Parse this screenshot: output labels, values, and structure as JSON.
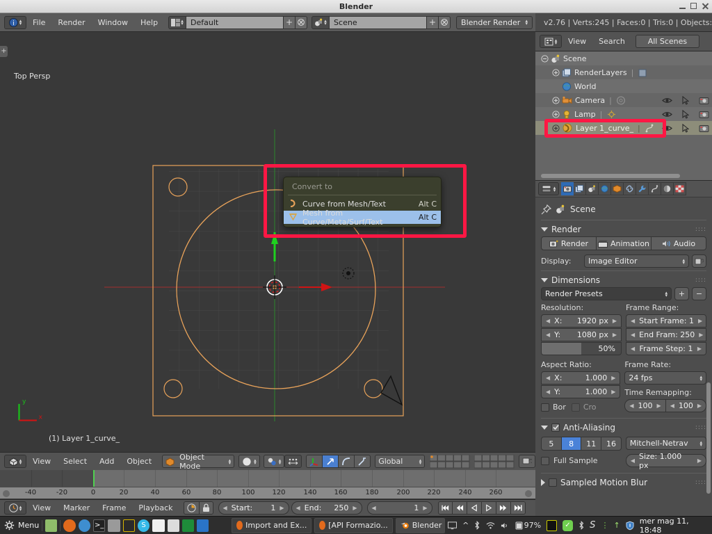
{
  "window": {
    "title": "Blender",
    "buttons": {
      "minimize": "minimize-button",
      "maximize": "maximize-button",
      "close": "close-button"
    }
  },
  "info_header": {
    "editor_type": "info-editor",
    "menus": [
      "File",
      "Render",
      "Window",
      "Help"
    ],
    "screen_layout": {
      "value": "Default",
      "add": "+",
      "remove": "x"
    },
    "scene": {
      "value": "Scene",
      "add": "+",
      "remove": "x"
    },
    "engine": {
      "value": "Blender Render"
    },
    "stats": "v2.76 | Verts:245 | Faces:0 | Tris:0 | Objects:"
  },
  "viewport": {
    "view_label": "Top Persp",
    "object_label": "(1) Layer 1_curve_",
    "axis_x": "x",
    "axis_y": "y",
    "plus_toggle": "+",
    "colors": {
      "curve": "#e9a35a",
      "grid": "#4a4a4a",
      "axis_x": "#a03232",
      "axis_y": "#3a8a3a",
      "bg": "#393939",
      "highlight_red": "#ff1744"
    }
  },
  "popup": {
    "title": "Convert to",
    "items": [
      {
        "label": "Curve from Mesh/Text",
        "underline": "C",
        "shortcut": "Alt C",
        "icon": "curve-icon",
        "highlighted": false
      },
      {
        "label": "Mesh from Curve/Meta/Surf/Text",
        "underline": "M",
        "shortcut": "Alt C",
        "icon": "mesh-cone-icon",
        "highlighted": true
      }
    ]
  },
  "viewport_header": {
    "editor_type": "3d-view-editor",
    "menus": [
      "View",
      "Select",
      "Add",
      "Object"
    ],
    "mode": "Object Mode",
    "viewport_shading": "solid-shading",
    "pivot": "pivot-median-point",
    "snap": "snap-magnet",
    "manipulators": [
      "translate-manipulator",
      "rotate-manipulator",
      "scale-manipulator"
    ],
    "transform_orientation": "Global",
    "layers": "layer-grid",
    "lock_scene": "lock-to-scene-icon",
    "proportional": "proportional-editing-icon"
  },
  "timeline": {
    "editor_type": "timeline-editor",
    "menus": [
      "View",
      "Marker",
      "Frame",
      "Playback"
    ],
    "auto_key": "record-icon",
    "lock": "lock-icon",
    "start_label": "Start:",
    "start_value": "1",
    "end_label": "End:",
    "end_value": "250",
    "current_frame": "1",
    "playhead_frame": 0,
    "ruler_ticks": [
      "-40",
      "-20",
      "0",
      "20",
      "40",
      "60",
      "80",
      "100",
      "120",
      "140",
      "160",
      "180",
      "200",
      "220",
      "240",
      "260"
    ],
    "transport": [
      "jump-start",
      "prev-keyframe",
      "play-reverse",
      "play",
      "next-keyframe",
      "jump-end"
    ]
  },
  "outliner": {
    "header": {
      "editor_type": "outliner-editor",
      "menus": [
        "View",
        "Search"
      ],
      "display_mode": "All Scenes"
    },
    "rows": [
      {
        "name": "Scene",
        "icon": "scene-icon",
        "depth": 0,
        "expander": "collapse",
        "selected": true,
        "has_toggles": false,
        "extra_icon": ""
      },
      {
        "name": "RenderLayers",
        "icon": "renderlayers-icon",
        "depth": 1,
        "expander": "expand",
        "selected": false,
        "has_toggles": false,
        "extra_icon": "renderlayers-data-icon"
      },
      {
        "name": "World",
        "icon": "world-icon",
        "depth": 1,
        "expander": "",
        "selected": false,
        "has_toggles": false,
        "extra_icon": ""
      },
      {
        "name": "Camera",
        "icon": "camera-icon",
        "depth": 1,
        "expander": "expand",
        "selected": false,
        "has_toggles": true,
        "extra_icon": "camera-data-icon"
      },
      {
        "name": "Lamp",
        "icon": "lamp-icon",
        "depth": 1,
        "expander": "expand",
        "selected": false,
        "has_toggles": true,
        "extra_icon": "lamp-data-icon"
      },
      {
        "name": "Layer 1_curve_",
        "icon": "curve-object-icon",
        "depth": 1,
        "expander": "expand",
        "selected": true,
        "has_toggles": true,
        "extra_icon": "curve-data-icon"
      }
    ],
    "row_toggles": [
      "eye-icon",
      "cursor-arrow-icon",
      "camera-render-icon"
    ]
  },
  "properties": {
    "tabs": [
      {
        "name": "render-tab",
        "sel": true
      },
      {
        "name": "render-layers-tab",
        "sel": false
      },
      {
        "name": "scene-tab",
        "sel": false
      },
      {
        "name": "world-tab",
        "sel": false
      },
      {
        "name": "object-tab",
        "sel": false
      },
      {
        "name": "constraints-tab",
        "sel": false
      },
      {
        "name": "modifiers-tab",
        "sel": false
      },
      {
        "name": "data-tab",
        "sel": false
      },
      {
        "name": "material-tab",
        "sel": false
      },
      {
        "name": "texture-tab",
        "sel": false
      }
    ],
    "breadcrumb": "Scene",
    "panels": {
      "render": {
        "title": "Render",
        "buttons": [
          "Render",
          "Animation",
          "Audio"
        ],
        "display_label": "Display:",
        "display_value": "Image Editor"
      },
      "dimensions": {
        "title": "Dimensions",
        "preset": "Render Presets",
        "resolution_label": "Resolution:",
        "res_x_label": "X:",
        "res_x_value": "1920 px",
        "res_y_label": "Y:",
        "res_y_value": "1080 px",
        "res_percent": "50%",
        "frame_range_label": "Frame Range:",
        "start_frame": "Start Frame: 1",
        "end_frame": "End Fram: 250",
        "frame_step": "Frame Step: 1",
        "aspect_label": "Aspect Ratio:",
        "aspect_x_label": "X:",
        "aspect_x_value": "1.000",
        "aspect_y_label": "Y:",
        "aspect_y_value": "1.000",
        "border_label": "Bor",
        "crop_label": "Cro",
        "frame_rate_label": "Frame Rate:",
        "frame_rate": "24 fps",
        "time_remap_label": "Time Remapping:",
        "time_remap_old": "100",
        "time_remap_new": "100"
      },
      "antialiasing": {
        "title": "Anti-Aliasing",
        "checked": true,
        "samples": [
          "5",
          "8",
          "11",
          "16"
        ],
        "selected_sample": "8",
        "filter": "Mitchell-Netrav",
        "full_sample_label": "Full Sample",
        "size_label": "Size: 1.000 px"
      },
      "motion_blur": {
        "title": "Sampled Motion Blur",
        "checked": false
      }
    }
  },
  "taskbar": {
    "menu_label": "Menu",
    "launchers": [
      "files-icon",
      "firefox-icon",
      "chromium-icon",
      "terminal-icon",
      "archive-icon",
      "monitor-icon",
      "skype-icon",
      "editor-icon",
      "calculator-icon",
      "spreadsheet-icon",
      "word-icon"
    ],
    "tasks": [
      {
        "label": "Import and Ex...",
        "icon": "firefox-icon",
        "active": false
      },
      {
        "label": "[API Formazio...",
        "icon": "firefox-icon",
        "active": false
      },
      {
        "label": "Blender",
        "icon": "blender-icon",
        "active": true
      }
    ],
    "tray": [
      "display-icon",
      "chevron-up-icon",
      "bluetooth-icon",
      "wifi-icon",
      "volume-icon",
      "battery-icon"
    ],
    "battery": "97%",
    "tray2": [
      "keyboard-layout-icon",
      "checkmark-icon",
      "bluetooth2-icon",
      "s-icon",
      "dots-icon",
      "update-arrow-icon",
      "shield-icon"
    ],
    "clock": "mer mag 11, 18:48"
  }
}
